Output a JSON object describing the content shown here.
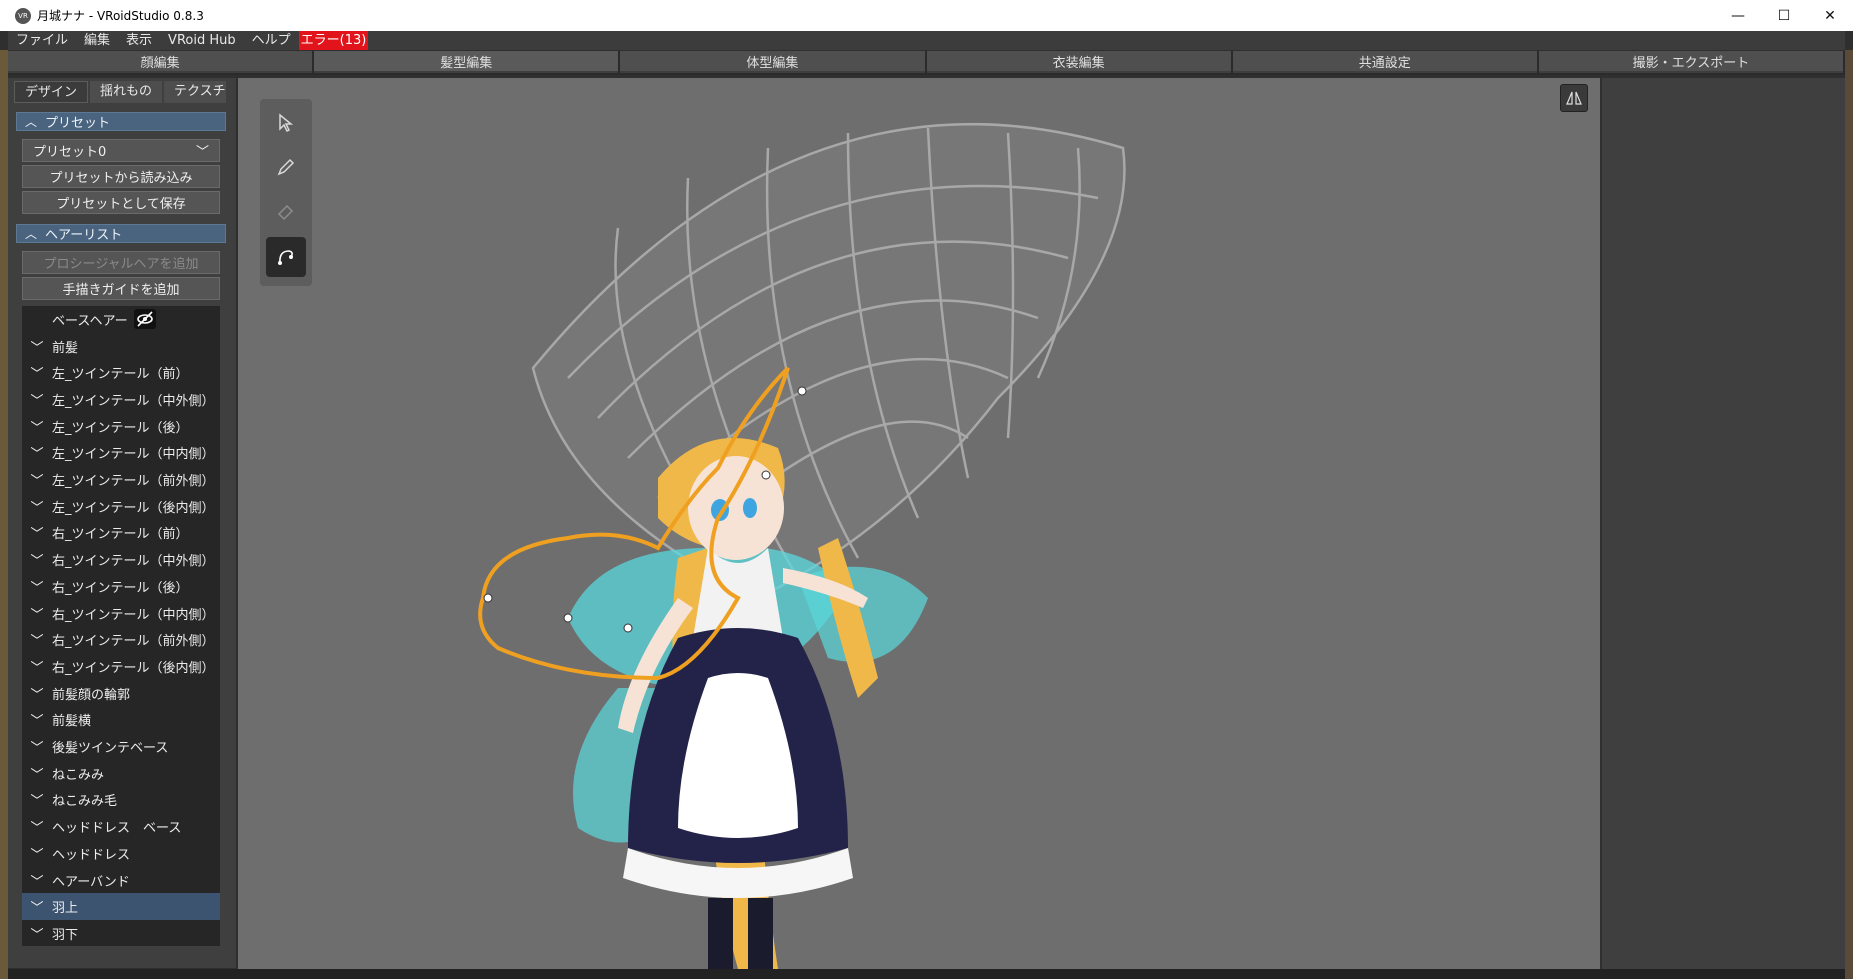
{
  "window": {
    "title": "月城ナナ - VRoidStudio 0.8.3",
    "icon_label": "VR",
    "controls": [
      "—",
      "☐",
      "✕"
    ]
  },
  "menu": {
    "items": [
      "ファイル",
      "編集",
      "表示",
      "VRoid Hub",
      "ヘルプ"
    ],
    "error_label": "エラー(13)"
  },
  "modes": [
    "顔編集",
    "髪型編集",
    "体型編集",
    "衣装編集",
    "共通設定",
    "撮影・エクスポート"
  ],
  "subtabs": [
    "デザイン",
    "揺れもの",
    "テクスチャ"
  ],
  "preset": {
    "header": "プリセット",
    "selected": "プリセット0",
    "load_button": "プリセットから読み込み",
    "save_button": "プリセットとして保存"
  },
  "hairlist": {
    "header": "ヘアーリスト",
    "add_procedural": "プロシージャルヘアを追加",
    "add_guide": "手描きガイドを追加",
    "base_hair": "ベースヘアー",
    "items": [
      "前髪",
      "左_ツインテール（前）",
      "左_ツインテール（中外側）",
      "左_ツインテール（後）",
      "左_ツインテール（中内側）",
      "左_ツインテール（前外側）",
      "左_ツインテール（後内側）",
      "右_ツインテール（前）",
      "右_ツインテール（中外側）",
      "右_ツインテール（後）",
      "右_ツインテール（中内側）",
      "右_ツインテール（前外側）",
      "右_ツインテール（後内側）",
      "前髪顔の輪郭",
      "前髪横",
      "後髪ツインテベース",
      "ねこみみ",
      "ねこみみ毛",
      "ヘッドドレス　ベース",
      "ヘッドドレス",
      "ヘアーバンド",
      "羽上",
      "羽下"
    ],
    "selected_index": 21
  },
  "colors": {
    "accent": "#4a6480",
    "selection": "#3d5470",
    "error": "#e0141a",
    "guide": "#f0a020"
  }
}
